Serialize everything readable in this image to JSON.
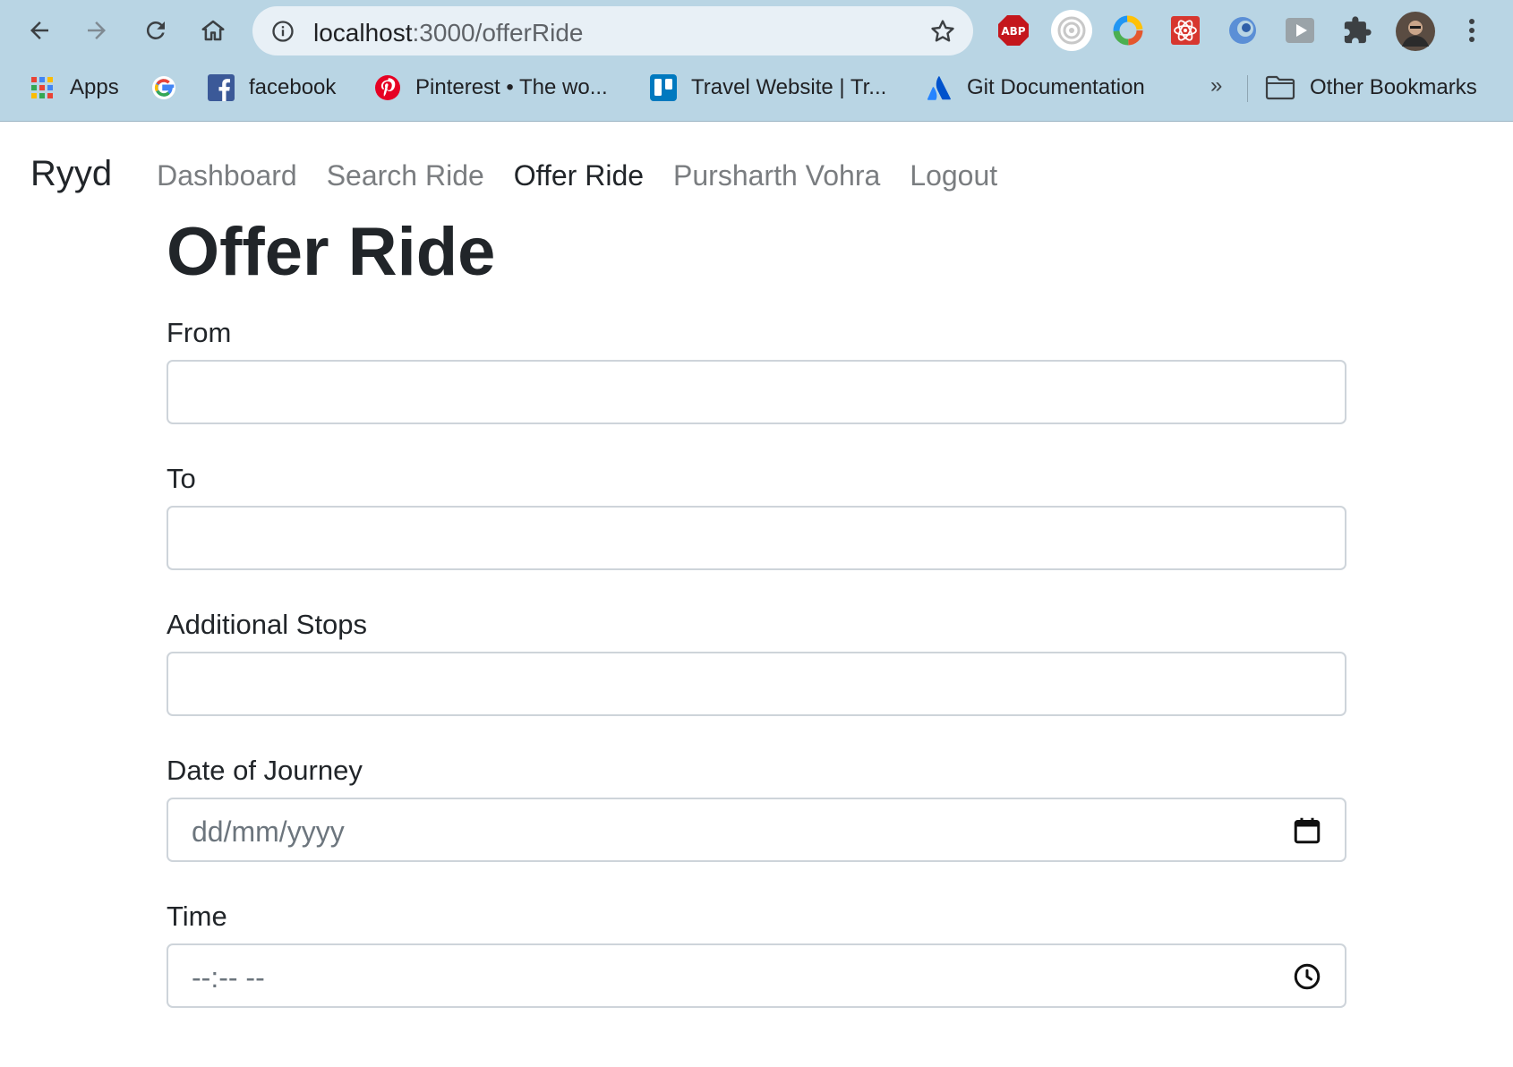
{
  "browser": {
    "url_host": "localhost",
    "url_path": ":3000/offerRide",
    "extensions": [
      "abp-extension-icon",
      "target-extension-icon",
      "color-extension-icon",
      "react-devtools-icon",
      "edge-extension-icon",
      "play-extension-icon",
      "puzzle-icon",
      "profile-avatar"
    ],
    "abp_label": "ABP",
    "bookmarks": [
      {
        "name": "bookmark-apps",
        "label": "Apps"
      },
      {
        "name": "bookmark-google",
        "label": ""
      },
      {
        "name": "bookmark-facebook",
        "label": "facebook"
      },
      {
        "name": "bookmark-pinterest",
        "label": "Pinterest • The wo..."
      },
      {
        "name": "bookmark-trello",
        "label": "Travel Website | Tr..."
      },
      {
        "name": "bookmark-git",
        "label": "Git Documentation"
      }
    ],
    "more_bookmarks": "»",
    "other_bookmarks": "Other Bookmarks"
  },
  "navbar": {
    "brand": "Ryyd",
    "links": [
      {
        "label": "Dashboard",
        "active": false
      },
      {
        "label": "Search Ride",
        "active": false
      },
      {
        "label": "Offer Ride",
        "active": true
      },
      {
        "label": "Pursharth Vohra",
        "active": false
      },
      {
        "label": "Logout",
        "active": false
      }
    ]
  },
  "form": {
    "title": "Offer Ride",
    "from_label": "From",
    "to_label": "To",
    "stops_label": "Additional Stops",
    "date_label": "Date of Journey",
    "date_placeholder": "dd/mm/yyyy",
    "time_label": "Time",
    "time_placeholder": "--:-- --"
  },
  "colors": {
    "chrome_bg": "#b9d5e4",
    "text_dark": "#212529",
    "nav_muted": "#7a7d80",
    "input_border": "#ced4da"
  }
}
